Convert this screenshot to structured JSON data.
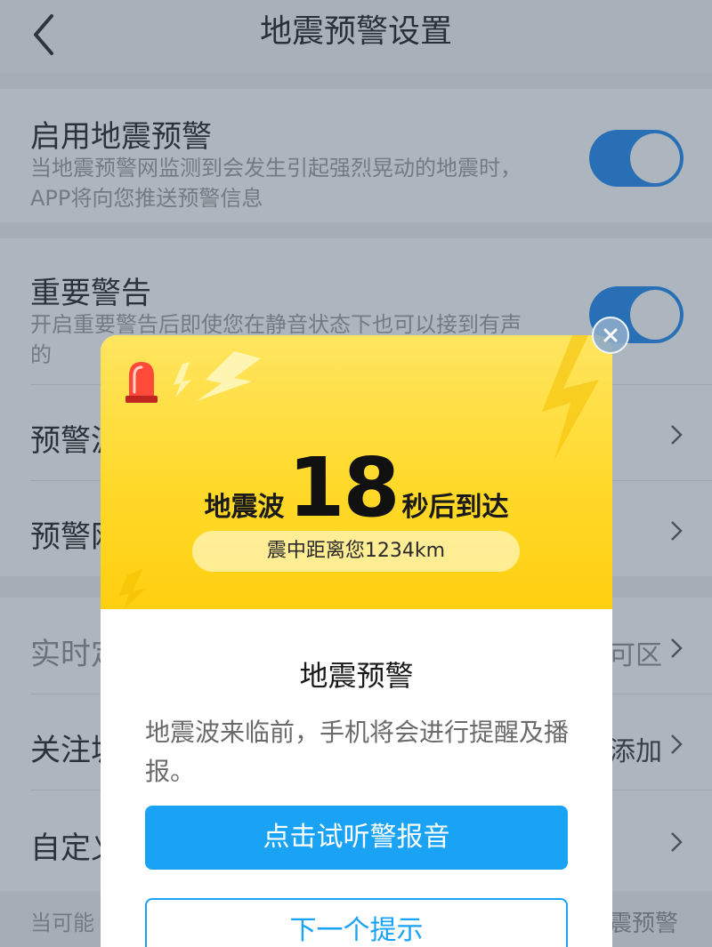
{
  "header": {
    "title": "地震预警设置"
  },
  "settings": {
    "enable_warning": {
      "title": "启用地震预警",
      "desc": "当地震预警网监测到会发生引起强烈晃动的地震时，APP将向您推送预警信息",
      "enabled": true
    },
    "important_alert": {
      "title": "重要警告",
      "desc": "开启重要警告后即使您在静音状态下也可以接到有声的",
      "enabled": true
    },
    "row3_title": "预警波",
    "row4_title": "预警网",
    "realtime": {
      "title": "实时定",
      "value": "可区"
    },
    "follow_city": {
      "title": "关注城",
      "value": "添加"
    },
    "custom": {
      "title": "自定义"
    },
    "footer_note": "当可能",
    "footer_right": "震预警"
  },
  "modal": {
    "countdown_prefix": "地震波",
    "countdown_seconds": "18",
    "countdown_suffix": "秒后到达",
    "distance_text": "震中距离您1234km",
    "title": "地震预警",
    "description": "地震波来临前，手机将会进行提醒及播报。",
    "primary_button": "点击试听警报音",
    "secondary_button": "下一个提示"
  },
  "colors": {
    "toggle_on": "#1a86f0",
    "hero_yellow": "#ffd92a",
    "primary_blue": "#1aa3f5"
  },
  "icons": [
    "back-chevron-icon",
    "alarm-siren-icon",
    "lightning-icon",
    "chevron-right-icon",
    "close-icon"
  ]
}
